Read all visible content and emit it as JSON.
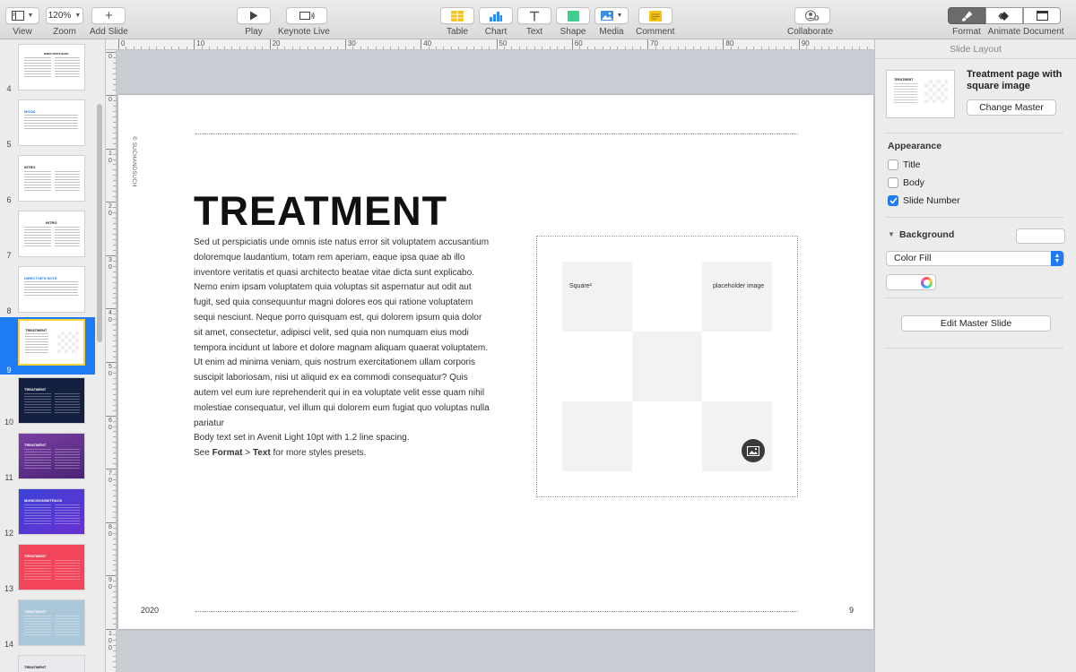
{
  "toolbar": {
    "view_label": "View",
    "zoom_value": "120%",
    "zoom_label": "Zoom",
    "add_slide_label": "Add Slide",
    "play_label": "Play",
    "keynote_live_label": "Keynote Live",
    "table_label": "Table",
    "chart_label": "Chart",
    "text_label": "Text",
    "shape_label": "Shape",
    "media_label": "Media",
    "comment_label": "Comment",
    "collaborate_label": "Collaborate",
    "format_label": "Format",
    "animate_label": "Animate",
    "document_label": "Document"
  },
  "navigator": {
    "slides": [
      {
        "number": "4",
        "title": "DIRECTOR'S NOTE"
      },
      {
        "number": "5",
        "title": "MOOD"
      },
      {
        "number": "6",
        "title": "INTRO"
      },
      {
        "number": "7",
        "title": "INTRO"
      },
      {
        "number": "8",
        "title": "DIRECTOR'S NOTE"
      },
      {
        "number": "9",
        "title": "TREATMENT"
      },
      {
        "number": "10",
        "title": "TREATMENT"
      },
      {
        "number": "11",
        "title": "TREATMENT"
      },
      {
        "number": "12",
        "title": "MUSIC/SOUNDTRACK"
      },
      {
        "number": "13",
        "title": "TREATMENT"
      },
      {
        "number": "14",
        "title": "TREATMENT"
      },
      {
        "number": "",
        "title": "TREATMENT"
      }
    ]
  },
  "ruler": {
    "top": [
      "0",
      "10",
      "20",
      "30",
      "40",
      "50",
      "60",
      "70",
      "80",
      "90"
    ],
    "left": [
      "0",
      "0",
      "10",
      "20",
      "30",
      "40",
      "50",
      "60",
      "70",
      "80",
      "90",
      "100"
    ]
  },
  "slide": {
    "credit": "© SUCHANDSUCH",
    "title": "TREATMENT",
    "body": "Sed ut perspiciatis unde omnis iste natus error sit voluptatem accusantium doloremque laudantium, totam rem aperiam, eaque ipsa quae ab illo inventore veritatis et quasi architecto beatae vitae dicta sunt explicabo. Nemo enim ipsam voluptatem quia voluptas sit aspernatur aut odit aut fugit, sed quia consequuntur magni dolores eos qui ratione voluptatem sequi nesciunt. Neque porro quisquam est, qui dolorem ipsum quia dolor sit amet, consectetur, adipisci velit, sed quia non numquam eius modi tempora incidunt ut labore et dolore magnam aliquam quaerat voluptatem. Ut enim ad minima veniam, quis nostrum exercitationem ullam corporis suscipit laboriosam, nisi ut aliquid ex ea commodi consequatur? Quis autem vel eum iure reprehenderit qui in ea voluptate velit esse quam nihil molestiae consequatur, vel illum qui dolorem eum fugiat quo voluptas nulla pariatur",
    "body_note": "Body text set in Avenit Light 10pt with 1.2 line spacing.",
    "hint_prefix": "See ",
    "hint_format": "Format",
    "hint_sep": " > ",
    "hint_text": "Text",
    "hint_suffix": " for more styles presets.",
    "placeholder_left": "Square²",
    "placeholder_right": "placeholder image",
    "year": "2020",
    "number": "9"
  },
  "inspector": {
    "header": "Slide Layout",
    "master_name": "Treatment page with square image",
    "change_master": "Change Master",
    "appearance_title": "Appearance",
    "checkbox_title": "Title",
    "checkbox_body": "Body",
    "checkbox_slide_number": "Slide Number",
    "background_title": "Background",
    "fill_type": "Color Fill",
    "edit_master": "Edit Master Slide"
  },
  "colors": {
    "accent": "#1f7bf3",
    "selection_border": "#f5d33b",
    "slide_bg": "#ffffff",
    "canvas_bg": "#c9ccd3"
  }
}
